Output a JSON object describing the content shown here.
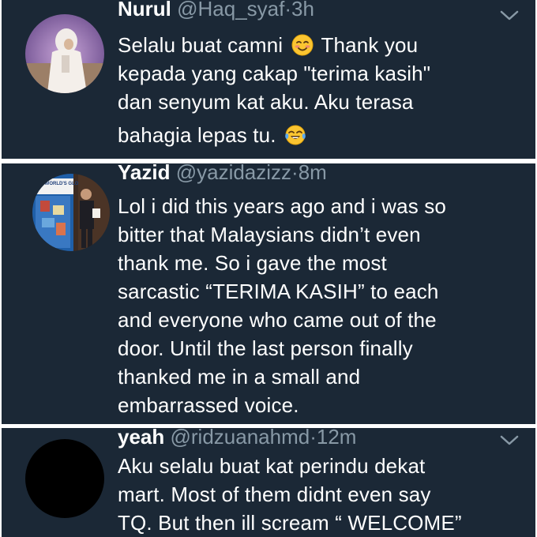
{
  "tweets": [
    {
      "name": "Nurul",
      "handle": "@Haq_syaf",
      "separator": "·",
      "time": "3h",
      "lines": [
        {
          "before": "Selalu buat camni ",
          "emoji": "blushing-smile-emoji",
          "after": " Thank you"
        },
        {
          "before": "kepada yang cakap \"terima kasih\"",
          "emoji": "",
          "after": ""
        },
        {
          "before": "dan senyum kat aku. Aku terasa",
          "emoji": "",
          "after": ""
        },
        {
          "before": "bahagia lepas tu. ",
          "emoji": "tears-of-joy-emoji",
          "after": ""
        }
      ]
    },
    {
      "name": "Yazid",
      "handle": "@yazidazizz",
      "separator": "·",
      "time": "8m",
      "avatar_banner_text": "THE WORLD'S GLOBAL UNITED",
      "lines": [
        {
          "before": "Lol i did this years ago and i was so",
          "emoji": "",
          "after": ""
        },
        {
          "before": "bitter that Malaysians didn’t even",
          "emoji": "",
          "after": ""
        },
        {
          "before": "thank me. So i gave the most",
          "emoji": "",
          "after": ""
        },
        {
          "before": "sarcastic “TERIMA KASIH” to each",
          "emoji": "",
          "after": ""
        },
        {
          "before": "and everyone who came out of the",
          "emoji": "",
          "after": ""
        },
        {
          "before": "door. Until the last person finally",
          "emoji": "",
          "after": ""
        },
        {
          "before": "thanked me in a small and",
          "emoji": "",
          "after": ""
        },
        {
          "before": "embarrassed voice.",
          "emoji": "",
          "after": ""
        }
      ]
    },
    {
      "name": "yeah",
      "handle": "@ridzuanahmd",
      "separator": "·",
      "time": "12m",
      "lines": [
        {
          "before": "Aku selalu buat kat perindu dekat",
          "emoji": "",
          "after": ""
        },
        {
          "before": "mart. Most of them didnt even say",
          "emoji": "",
          "after": ""
        },
        {
          "before": "TQ. But then ill scream “ WELCOME”",
          "emoji": "",
          "after": ""
        }
      ]
    }
  ],
  "colors": {
    "background": "#1b2836",
    "text": "#ffffff",
    "muted": "#8899a6",
    "divider": "#ffffff"
  },
  "icons": {
    "caret": "chevron-down-icon"
  }
}
